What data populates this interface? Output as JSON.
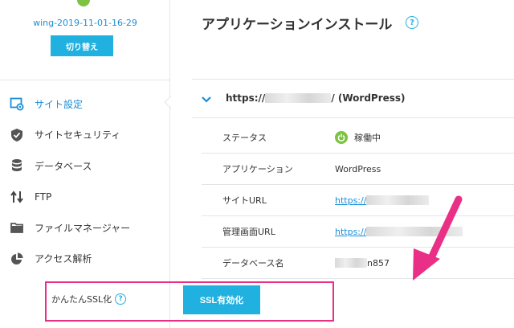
{
  "sidebar": {
    "server_name": "wing-2019-11-01-16-29",
    "switch_label": "切り替え",
    "items": [
      {
        "label": "サイト設定",
        "icon": "site-settings-icon",
        "active": true
      },
      {
        "label": "サイトセキュリティ",
        "icon": "shield-check-icon",
        "active": false
      },
      {
        "label": "データベース",
        "icon": "database-icon",
        "active": false
      },
      {
        "label": "FTP",
        "icon": "transfer-arrows-icon",
        "active": false
      },
      {
        "label": "ファイルマネージャー",
        "icon": "folder-icon",
        "active": false
      },
      {
        "label": "アクセス解析",
        "icon": "pie-chart-icon",
        "active": false
      }
    ]
  },
  "main": {
    "title": "アプリケーションインストール",
    "site": {
      "url_prefix": "https://",
      "url_suffix": "/ (WordPress)"
    },
    "rows": [
      {
        "label": "ステータス",
        "value": "稼働中"
      },
      {
        "label": "アプリケーション",
        "value": "WordPress"
      },
      {
        "label": "サイトURL",
        "value": "https://"
      },
      {
        "label": "管理画面URL",
        "value": "https://"
      },
      {
        "label": "データベース名",
        "value": "n857"
      }
    ],
    "ssl": {
      "label": "かんたんSSL化",
      "button": "SSL有効化"
    },
    "help_glyph": "?"
  },
  "colors": {
    "accent": "#21b1e0",
    "link": "#1a8fd8",
    "highlight": "#ea2f86",
    "status_green": "#7dc242"
  }
}
